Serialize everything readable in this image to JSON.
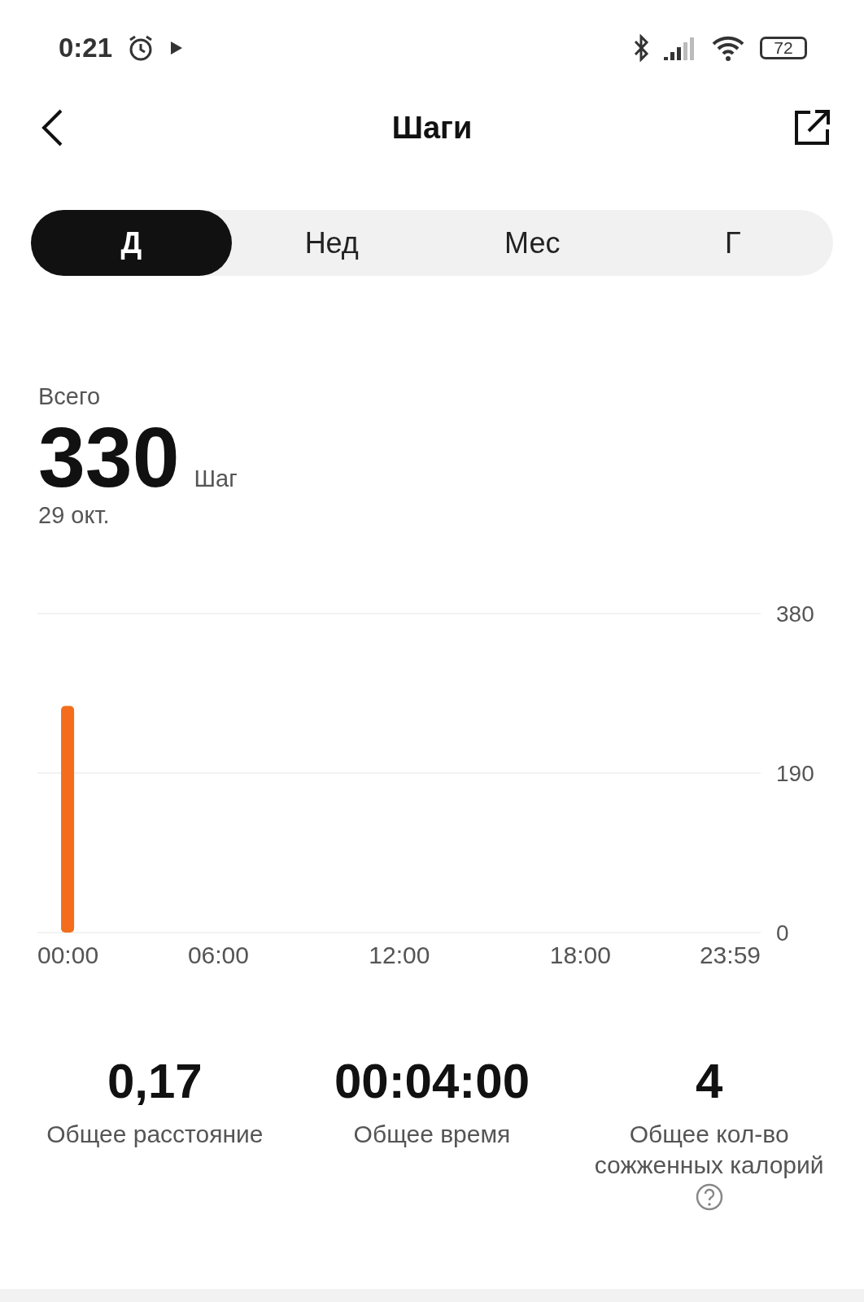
{
  "status_bar": {
    "time": "0:21",
    "battery": "72"
  },
  "header": {
    "title": "Шаги"
  },
  "tabs": [
    {
      "label": "Д",
      "selected": true
    },
    {
      "label": "Нед",
      "selected": false
    },
    {
      "label": "Мес",
      "selected": false
    },
    {
      "label": "Г",
      "selected": false
    }
  ],
  "summary": {
    "label": "Всего",
    "value": "330",
    "unit": "Шаг",
    "date": "29 окт."
  },
  "chart": {
    "chart_data": {
      "type": "bar",
      "x": [
        1
      ],
      "values": [
        270
      ],
      "xlim": [
        0,
        23.98
      ],
      "ylim": [
        0,
        380
      ],
      "yticks": [
        0,
        190,
        380
      ],
      "xticks": [
        {
          "value": 0,
          "label": "00:00"
        },
        {
          "value": 6,
          "label": "06:00"
        },
        {
          "value": 12,
          "label": "12:00"
        },
        {
          "value": 18,
          "label": "18:00"
        },
        {
          "value": 23.98,
          "label": "23:59"
        }
      ]
    }
  },
  "stats": [
    {
      "value": "0,17",
      "label": "Общее расстояние"
    },
    {
      "value": "00:04:00",
      "label": "Общее время"
    },
    {
      "value": "4",
      "label": "Общее кол-во сожженных калорий",
      "help": true
    }
  ]
}
